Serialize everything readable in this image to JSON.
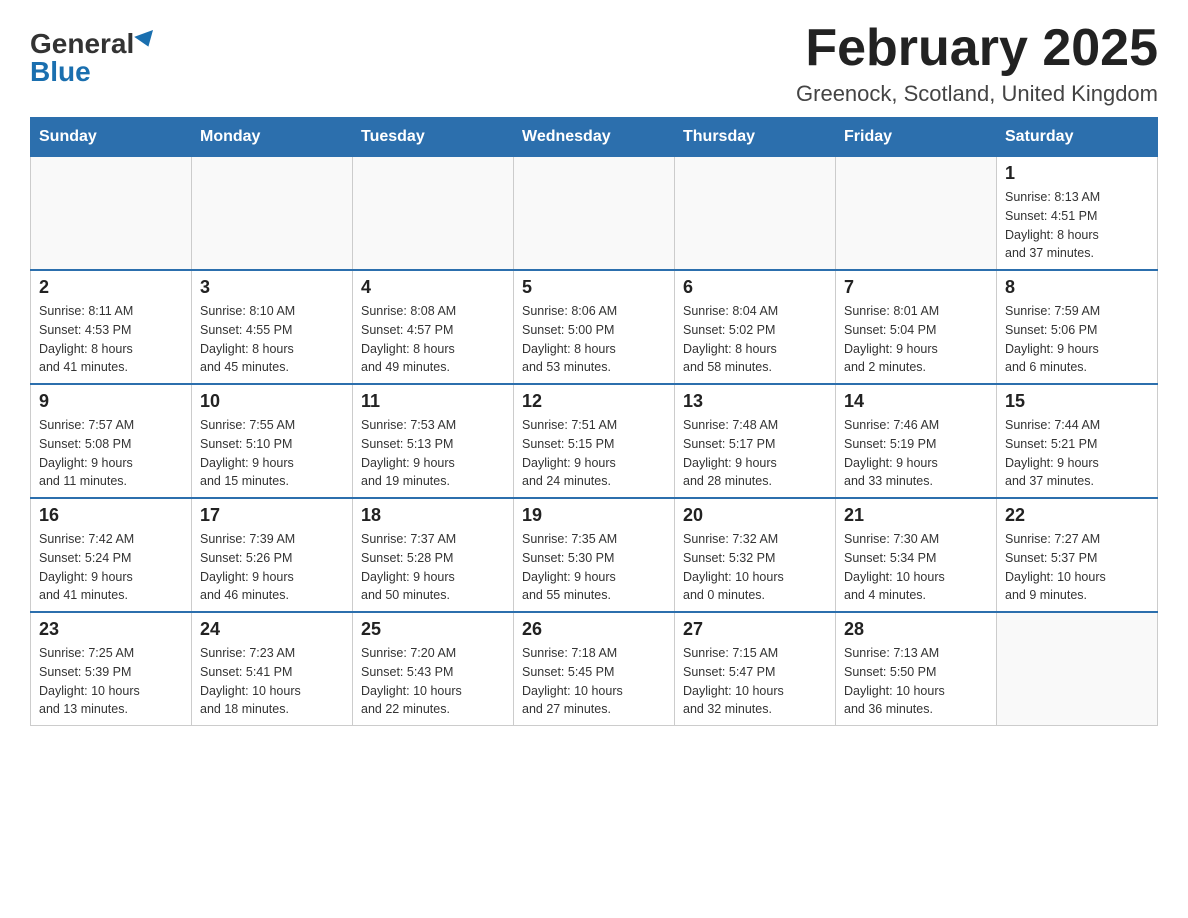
{
  "header": {
    "logo_general": "General",
    "logo_blue": "Blue",
    "month_title": "February 2025",
    "location": "Greenock, Scotland, United Kingdom"
  },
  "weekdays": [
    "Sunday",
    "Monday",
    "Tuesday",
    "Wednesday",
    "Thursday",
    "Friday",
    "Saturday"
  ],
  "weeks": [
    [
      {
        "day": "",
        "info": ""
      },
      {
        "day": "",
        "info": ""
      },
      {
        "day": "",
        "info": ""
      },
      {
        "day": "",
        "info": ""
      },
      {
        "day": "",
        "info": ""
      },
      {
        "day": "",
        "info": ""
      },
      {
        "day": "1",
        "info": "Sunrise: 8:13 AM\nSunset: 4:51 PM\nDaylight: 8 hours\nand 37 minutes."
      }
    ],
    [
      {
        "day": "2",
        "info": "Sunrise: 8:11 AM\nSunset: 4:53 PM\nDaylight: 8 hours\nand 41 minutes."
      },
      {
        "day": "3",
        "info": "Sunrise: 8:10 AM\nSunset: 4:55 PM\nDaylight: 8 hours\nand 45 minutes."
      },
      {
        "day": "4",
        "info": "Sunrise: 8:08 AM\nSunset: 4:57 PM\nDaylight: 8 hours\nand 49 minutes."
      },
      {
        "day": "5",
        "info": "Sunrise: 8:06 AM\nSunset: 5:00 PM\nDaylight: 8 hours\nand 53 minutes."
      },
      {
        "day": "6",
        "info": "Sunrise: 8:04 AM\nSunset: 5:02 PM\nDaylight: 8 hours\nand 58 minutes."
      },
      {
        "day": "7",
        "info": "Sunrise: 8:01 AM\nSunset: 5:04 PM\nDaylight: 9 hours\nand 2 minutes."
      },
      {
        "day": "8",
        "info": "Sunrise: 7:59 AM\nSunset: 5:06 PM\nDaylight: 9 hours\nand 6 minutes."
      }
    ],
    [
      {
        "day": "9",
        "info": "Sunrise: 7:57 AM\nSunset: 5:08 PM\nDaylight: 9 hours\nand 11 minutes."
      },
      {
        "day": "10",
        "info": "Sunrise: 7:55 AM\nSunset: 5:10 PM\nDaylight: 9 hours\nand 15 minutes."
      },
      {
        "day": "11",
        "info": "Sunrise: 7:53 AM\nSunset: 5:13 PM\nDaylight: 9 hours\nand 19 minutes."
      },
      {
        "day": "12",
        "info": "Sunrise: 7:51 AM\nSunset: 5:15 PM\nDaylight: 9 hours\nand 24 minutes."
      },
      {
        "day": "13",
        "info": "Sunrise: 7:48 AM\nSunset: 5:17 PM\nDaylight: 9 hours\nand 28 minutes."
      },
      {
        "day": "14",
        "info": "Sunrise: 7:46 AM\nSunset: 5:19 PM\nDaylight: 9 hours\nand 33 minutes."
      },
      {
        "day": "15",
        "info": "Sunrise: 7:44 AM\nSunset: 5:21 PM\nDaylight: 9 hours\nand 37 minutes."
      }
    ],
    [
      {
        "day": "16",
        "info": "Sunrise: 7:42 AM\nSunset: 5:24 PM\nDaylight: 9 hours\nand 41 minutes."
      },
      {
        "day": "17",
        "info": "Sunrise: 7:39 AM\nSunset: 5:26 PM\nDaylight: 9 hours\nand 46 minutes."
      },
      {
        "day": "18",
        "info": "Sunrise: 7:37 AM\nSunset: 5:28 PM\nDaylight: 9 hours\nand 50 minutes."
      },
      {
        "day": "19",
        "info": "Sunrise: 7:35 AM\nSunset: 5:30 PM\nDaylight: 9 hours\nand 55 minutes."
      },
      {
        "day": "20",
        "info": "Sunrise: 7:32 AM\nSunset: 5:32 PM\nDaylight: 10 hours\nand 0 minutes."
      },
      {
        "day": "21",
        "info": "Sunrise: 7:30 AM\nSunset: 5:34 PM\nDaylight: 10 hours\nand 4 minutes."
      },
      {
        "day": "22",
        "info": "Sunrise: 7:27 AM\nSunset: 5:37 PM\nDaylight: 10 hours\nand 9 minutes."
      }
    ],
    [
      {
        "day": "23",
        "info": "Sunrise: 7:25 AM\nSunset: 5:39 PM\nDaylight: 10 hours\nand 13 minutes."
      },
      {
        "day": "24",
        "info": "Sunrise: 7:23 AM\nSunset: 5:41 PM\nDaylight: 10 hours\nand 18 minutes."
      },
      {
        "day": "25",
        "info": "Sunrise: 7:20 AM\nSunset: 5:43 PM\nDaylight: 10 hours\nand 22 minutes."
      },
      {
        "day": "26",
        "info": "Sunrise: 7:18 AM\nSunset: 5:45 PM\nDaylight: 10 hours\nand 27 minutes."
      },
      {
        "day": "27",
        "info": "Sunrise: 7:15 AM\nSunset: 5:47 PM\nDaylight: 10 hours\nand 32 minutes."
      },
      {
        "day": "28",
        "info": "Sunrise: 7:13 AM\nSunset: 5:50 PM\nDaylight: 10 hours\nand 36 minutes."
      },
      {
        "day": "",
        "info": ""
      }
    ]
  ]
}
